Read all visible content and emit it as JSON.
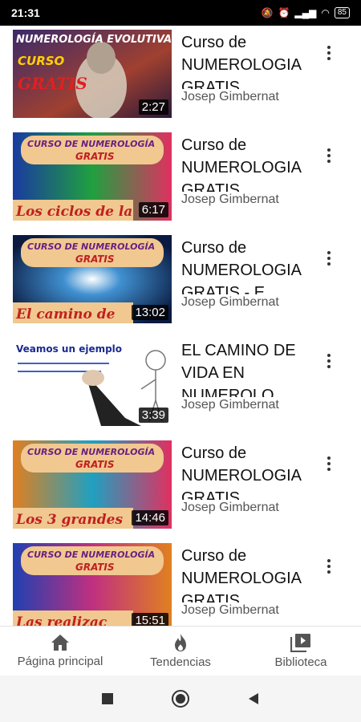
{
  "status_bar": {
    "time": "21:31",
    "battery": "85"
  },
  "videos": [
    {
      "title": "Curso de NUMEROLOGIA GRATIS",
      "channel": "Josep Gimbernat",
      "duration": "2:27",
      "thumb_lines": [
        "NUMEROLOGÍA EVOLUTIVA",
        "CURSO",
        "GRATIS"
      ]
    },
    {
      "title": "Curso de NUMEROLOGIA GRATIS",
      "channel": "Josep Gimbernat",
      "duration": "6:17",
      "thumb_lines": [
        "CURSO DE NUMEROLOGÍA",
        "GRATIS",
        "Los ciclos de la"
      ]
    },
    {
      "title": "Curso de NUMEROLOGIA GRATIS - E",
      "channel": "Josep Gimbernat",
      "duration": "13:02",
      "thumb_lines": [
        "CURSO DE NUMEROLOGÍA",
        "GRATIS",
        "El camino de"
      ]
    },
    {
      "title": "EL CAMINO DE VIDA EN NUMEROLO",
      "channel": "Josep Gimbernat",
      "duration": "3:39",
      "thumb_lines": [
        "Veamos un ejemplo"
      ]
    },
    {
      "title": "Curso de NUMEROLOGIA GRATIS",
      "channel": "Josep Gimbernat",
      "duration": "14:46",
      "thumb_lines": [
        "CURSO DE NUMEROLOGÍA",
        "GRATIS",
        "Los 3 grandes"
      ]
    },
    {
      "title": "Curso de NUMEROLOGIA GRATIS",
      "channel": "Josep Gimbernat",
      "duration": "15:51",
      "thumb_lines": [
        "CURSO DE NUMEROLOGÍA",
        "GRATIS",
        "Las realizac"
      ]
    }
  ],
  "bottom_nav": {
    "home": "Página principal",
    "trending": "Tendencias",
    "library": "Biblioteca"
  },
  "colors": {
    "status_bg": "#000000",
    "text_primary": "#111111",
    "text_secondary": "#555555",
    "duration_bg": "#000000"
  }
}
